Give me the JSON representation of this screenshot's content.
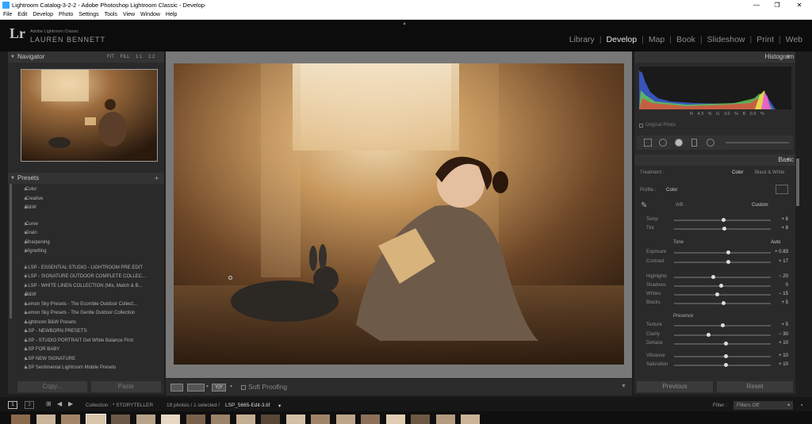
{
  "window": {
    "title": "Lightroom Catalog-3-2-2 - Adobe Photoshop Lightroom Classic - Develop",
    "controls": [
      "—",
      "❐",
      "✕"
    ]
  },
  "menu": [
    "File",
    "Edit",
    "Develop",
    "Photo",
    "Settings",
    "Tools",
    "View",
    "Window",
    "Help"
  ],
  "identity": {
    "logo": "Lr",
    "small": "Adobe Lightroom Classic",
    "name": "LAUREN BENNETT"
  },
  "modules": [
    "Library",
    "Develop",
    "Map",
    "Book",
    "Slideshow",
    "Print",
    "Web"
  ],
  "active_module": "Develop",
  "navigator": {
    "label": "Navigator",
    "zoom": "FIT FILL 1:1 1:2"
  },
  "presets": {
    "label": "Presets",
    "add": "+",
    "groups_a": [
      "Color",
      "Creative",
      "B&W"
    ],
    "groups_b": [
      "Curve",
      "Grain",
      "Sharpening",
      "Vignetting"
    ],
    "groups_c": [
      "! LSP - ESSENTIAL STUDIO - LIGHTROOM PRE EDIT",
      "! LSP - SIGNATURE OUTDOOR COMPLETE COLLEC...",
      "! LSP - WHITE LINEN COLLECTION  (Mix, Match & B...",
      "B&W",
      "Lemon Sky Presets - The Ecombie Outdoor Collect...",
      "Lemon Sky Presets - The Gentle Outdoor Collection",
      "Lightroom B&W Presets",
      "LSP - NEWBORN PRESETS",
      "LSP - STUDIO PORTRAIT Get White Balance First",
      "LSP FOR BABY",
      "LSP NEW SIGNATURE",
      "LSP Sentimental Lightroom Mobile Presets"
    ]
  },
  "left_buttons": {
    "copy": "Copy...",
    "paste": "Paste"
  },
  "toolbar": {
    "softproof": "Soft Proofing",
    "compare": "Y|Y"
  },
  "histogram": {
    "label": "Histogram",
    "values": "R  4.3  %   G  3.0  %   B  0.9  %",
    "original": "Original Photo"
  },
  "basic": {
    "label": "Basic",
    "treatment_label": "Treatment :",
    "treatment_color": "Color",
    "treatment_bw": "Black & White",
    "profile_label": "Profile :",
    "profile_value": "Color",
    "wb_label": "WB :",
    "wb_value": "Custom",
    "tone_label": "Tone",
    "auto": "Auto",
    "presence_label": "Presence"
  },
  "sliders": [
    {
      "label": "Temp",
      "value": "+ 6",
      "pos": 0.51
    },
    {
      "label": "Tint",
      "value": "+ 8",
      "pos": 0.52
    },
    {
      "label": "Exposure",
      "value": "+ 0.83",
      "pos": 0.56
    },
    {
      "label": "Contrast",
      "value": "+ 17",
      "pos": 0.56
    },
    {
      "label": "Highlights",
      "value": "− 20",
      "pos": 0.4
    },
    {
      "label": "Shadows",
      "value": "0",
      "pos": 0.48
    },
    {
      "label": "Whites",
      "value": "− 15",
      "pos": 0.44
    },
    {
      "label": "Blacks",
      "value": "+ 5",
      "pos": 0.51
    },
    {
      "label": "Texture",
      "value": "+ 5",
      "pos": 0.5
    },
    {
      "label": "Clarity",
      "value": "− 30",
      "pos": 0.35
    },
    {
      "label": "Dehaze",
      "value": "+ 10",
      "pos": 0.53
    },
    {
      "label": "Vibrance",
      "value": "+ 10",
      "pos": 0.53
    },
    {
      "label": "Saturation",
      "value": "+ 10",
      "pos": 0.53
    }
  ],
  "right_buttons": {
    "previous": "Previous",
    "reset": "Reset"
  },
  "filmstrip": {
    "pages": [
      "1",
      "2"
    ],
    "collection": "Collection : * STORYTELLER",
    "count": "19 photos / 1 selected /",
    "filename": "LSP_5665-Edit-3.tif",
    "filter_label": "Filter :",
    "filter_value": "Filters Off"
  }
}
